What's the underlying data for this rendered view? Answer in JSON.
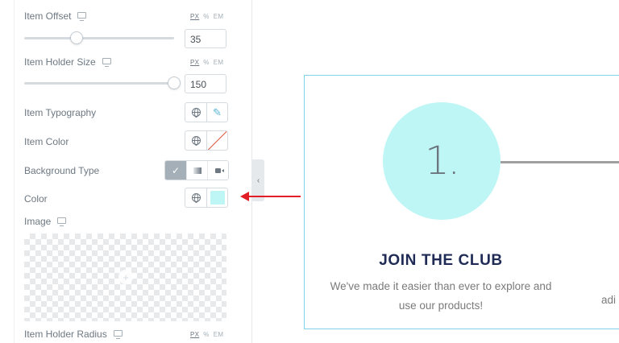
{
  "panel": {
    "item_offset": {
      "label": "Item Offset",
      "units": [
        "PX",
        "%",
        "EM"
      ],
      "active_unit": "PX",
      "value": "35",
      "slider_fraction": 0.35
    },
    "item_holder_size": {
      "label": "Item Holder Size",
      "units": [
        "PX",
        "%",
        "EM"
      ],
      "active_unit": "PX",
      "value": "150",
      "slider_fraction": 1.0
    },
    "item_typography": {
      "label": "Item Typography",
      "icons": [
        "globe-icon",
        "pencil-icon"
      ]
    },
    "item_color": {
      "label": "Item Color",
      "icons": [
        "globe-icon",
        "no-color-swatch"
      ]
    },
    "background_type": {
      "label": "Background Type",
      "options": [
        "classic-brush-icon",
        "gradient-icon",
        "video-icon"
      ],
      "active": "classic-brush-icon"
    },
    "color": {
      "label": "Color",
      "swatch_color": "#bdf6f4"
    },
    "image": {
      "label": "Image",
      "placeholder_icon": "plus-icon"
    },
    "item_holder_radius": {
      "label": "Item Holder Radius",
      "units": [
        "PX",
        "%",
        "EM"
      ],
      "active_unit": "PX"
    }
  },
  "collapse_icon": "‹",
  "annotation": {
    "arrow_color": "#e21d25"
  },
  "preview": {
    "step_number": "1.",
    "title": "JOIN THE CLUB",
    "description_line1": "We've made it easier than ever to explore and",
    "description_line2": "use our products!",
    "next_step_partial_text": "adi",
    "circle_color": "#bdf6f4",
    "border_color": "#7fd3e6",
    "title_color": "#1f2a55"
  }
}
